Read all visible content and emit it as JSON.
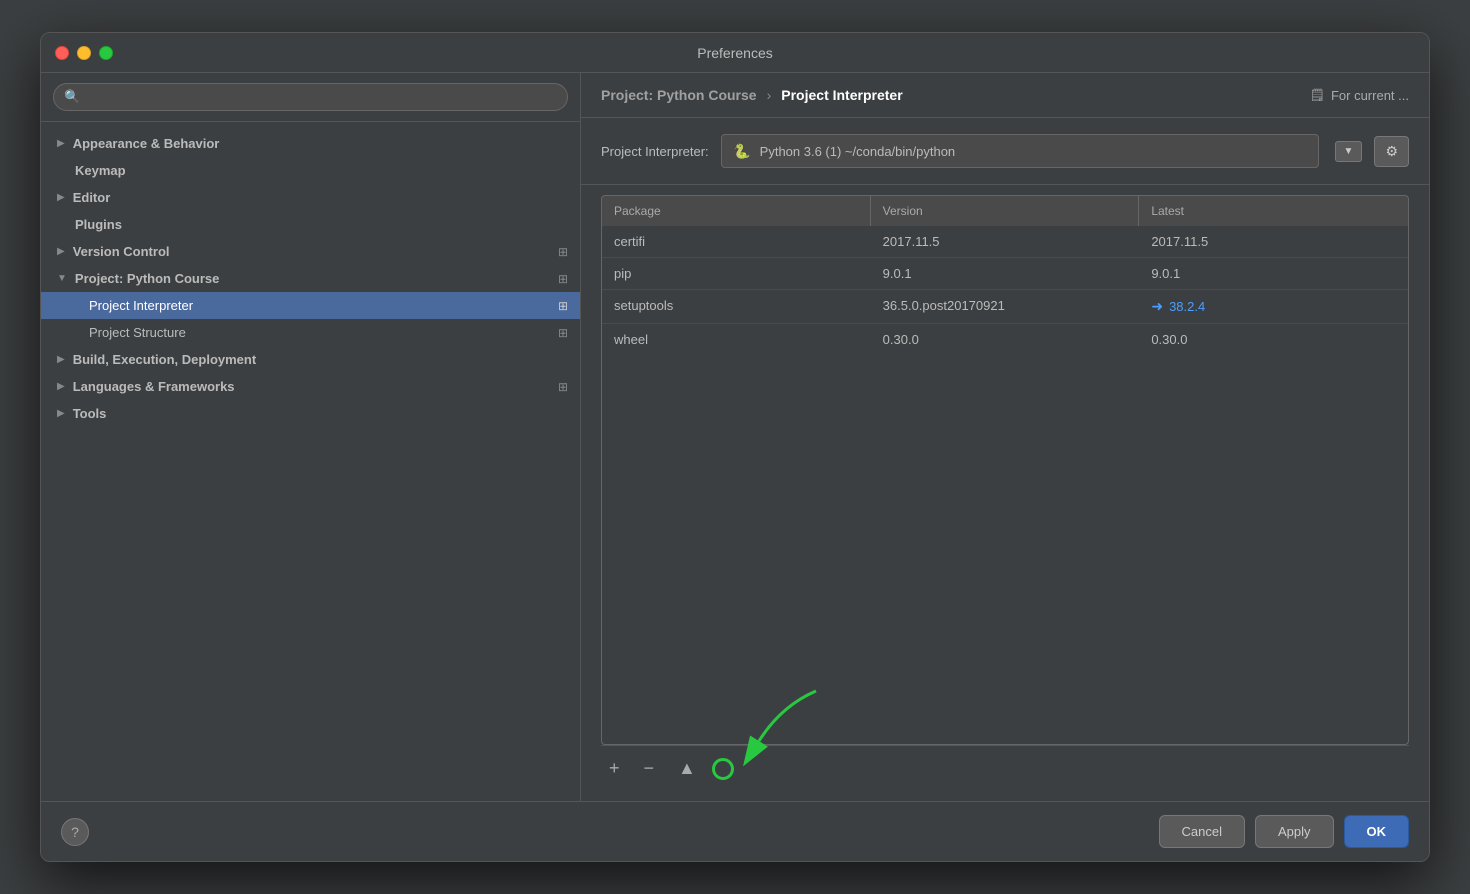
{
  "dialog": {
    "title": "Preferences"
  },
  "sidebar": {
    "search_placeholder": "🔍",
    "items": [
      {
        "id": "appearance",
        "label": "Appearance & Behavior",
        "level": 0,
        "has_arrow": true,
        "has_icon": false,
        "active": false
      },
      {
        "id": "keymap",
        "label": "Keymap",
        "level": 0,
        "has_arrow": false,
        "has_icon": false,
        "active": false
      },
      {
        "id": "editor",
        "label": "Editor",
        "level": 0,
        "has_arrow": true,
        "has_icon": false,
        "active": false
      },
      {
        "id": "plugins",
        "label": "Plugins",
        "level": 0,
        "has_arrow": false,
        "has_icon": false,
        "active": false
      },
      {
        "id": "version-control",
        "label": "Version Control",
        "level": 0,
        "has_arrow": true,
        "has_icon": true,
        "active": false
      },
      {
        "id": "project-python-course",
        "label": "Project: Python Course",
        "level": 0,
        "has_arrow": true,
        "expanded": true,
        "has_icon": true,
        "active": false
      },
      {
        "id": "project-interpreter",
        "label": "Project Interpreter",
        "level": 1,
        "has_arrow": false,
        "has_icon": true,
        "active": true
      },
      {
        "id": "project-structure",
        "label": "Project Structure",
        "level": 1,
        "has_arrow": false,
        "has_icon": true,
        "active": false
      },
      {
        "id": "build-execution",
        "label": "Build, Execution, Deployment",
        "level": 0,
        "has_arrow": true,
        "has_icon": false,
        "active": false
      },
      {
        "id": "languages-frameworks",
        "label": "Languages & Frameworks",
        "level": 0,
        "has_arrow": true,
        "has_icon": true,
        "active": false
      },
      {
        "id": "tools",
        "label": "Tools",
        "level": 0,
        "has_arrow": true,
        "has_icon": false,
        "active": false
      }
    ]
  },
  "breadcrumb": {
    "parent": "Project: Python Course",
    "separator": "›",
    "current": "Project Interpreter",
    "for_current_label": "For current ..."
  },
  "interpreter": {
    "label": "Project Interpreter:",
    "python_icon": "🐍",
    "name": "Python 3.6 (1)  ~/conda/bin/python",
    "dropdown_char": "▼",
    "gear_char": "⚙"
  },
  "table": {
    "columns": [
      "Package",
      "Version",
      "Latest"
    ],
    "rows": [
      {
        "package": "certifi",
        "version": "2017.11.5",
        "latest": "2017.11.5",
        "has_update": false
      },
      {
        "package": "pip",
        "version": "9.0.1",
        "latest": "9.0.1",
        "has_update": false
      },
      {
        "package": "setuptools",
        "version": "36.5.0.post20170921",
        "latest": "38.2.4",
        "has_update": true
      },
      {
        "package": "wheel",
        "version": "0.30.0",
        "latest": "0.30.0",
        "has_update": false
      }
    ]
  },
  "toolbar": {
    "add_label": "+",
    "remove_label": "−",
    "upgrade_label": "▲"
  },
  "footer": {
    "help_label": "?",
    "cancel_label": "Cancel",
    "apply_label": "Apply",
    "ok_label": "OK"
  }
}
